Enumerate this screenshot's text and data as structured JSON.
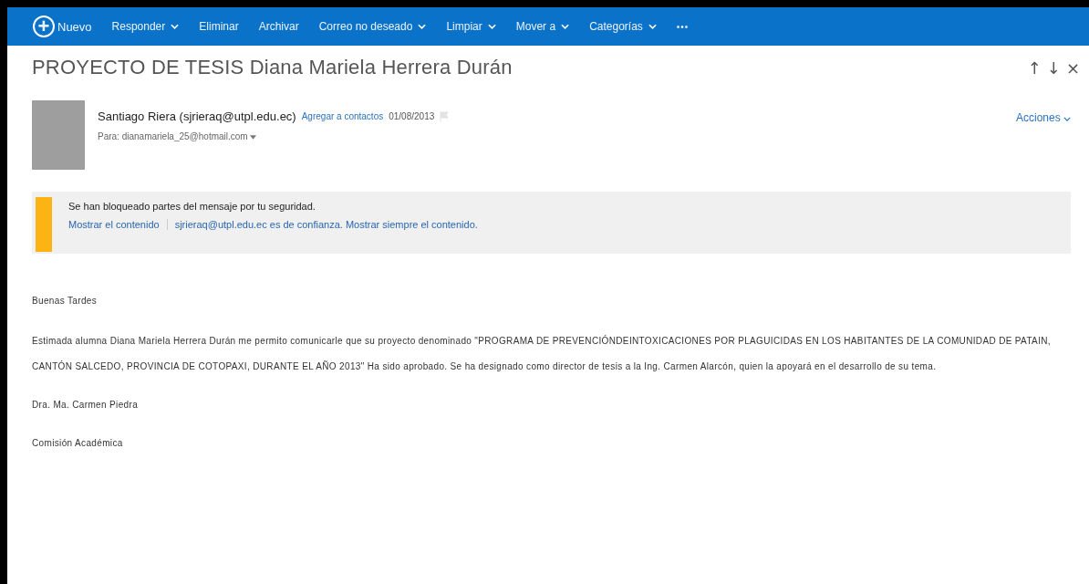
{
  "toolbar": {
    "new_button": {
      "icon": "+",
      "label": "Nuevo"
    },
    "items": [
      {
        "label": "Responder",
        "dropdown": true
      },
      {
        "label": "Eliminar",
        "dropdown": false
      },
      {
        "label": "Archivar",
        "dropdown": false
      },
      {
        "label": "Correo no deseado",
        "dropdown": true
      },
      {
        "label": "Limpiar",
        "dropdown": true
      },
      {
        "label": "Mover a",
        "dropdown": true
      },
      {
        "label": "Categorías",
        "dropdown": true
      }
    ],
    "more": "•••"
  },
  "message": {
    "subject": "PROYECTO DE TESIS Diana Mariela Herrera Durán",
    "nav": [
      "↑",
      "↓",
      "×"
    ],
    "sender": "Santiago Riera (sjrieraq@utpl.edu.ec)",
    "add_contact": "Agregar a contactos",
    "date": "01/08/2013",
    "flagged": false,
    "to": "Para: dianamariela_25@hotmail.com",
    "actions": "Acciones",
    "warning": {
      "text": "Se han bloqueado partes del mensaje por tu seguridad.",
      "links": [
        "Mostrar el contenido",
        "sjrieraq@utpl.edu.ec es de confianza. Mostrar siempre el contenido."
      ]
    },
    "body": [
      "Buenas Tardes",
      "Estimada alumna Diana Mariela Herrera Durán me permito comunicarle que su proyecto denominado \"PROGRAMA DE PREVENCIÓNDEINTOXICACIONES POR PLAGUICIDAS EN LOS HABITANTES DE LA COMUNIDAD DE PATAIN, CANTÓN SALCEDO, PROVINCIA DE COTOPAXI, DURANTE EL AÑO 2013\" Ha sido aprobado. Se ha designado como director de tesis a la Ing. Carmen Alarcón, quien la apoyará en el desarrollo de su tema.",
      "Dra. Ma. Carmen Piedra",
      "Comisión Académica"
    ]
  }
}
